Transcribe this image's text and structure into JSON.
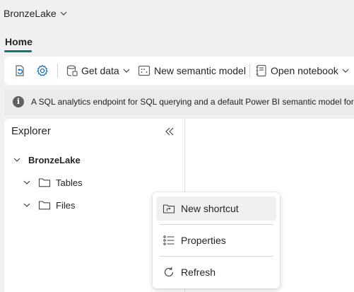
{
  "workspace": {
    "name": "BronzeLake"
  },
  "tabs": [
    {
      "label": "Home",
      "active": true
    }
  ],
  "ribbon": {
    "get_data_label": "Get data",
    "new_semantic_model_label": "New semantic model",
    "open_notebook_label": "Open notebook"
  },
  "info_bar": {
    "message": "A SQL analytics endpoint for SQL querying and a default Power BI semantic model for r"
  },
  "explorer": {
    "title": "Explorer",
    "tree": {
      "root": "BronzeLake",
      "children": [
        {
          "label": "Tables"
        },
        {
          "label": "Files"
        }
      ]
    }
  },
  "context_menu": {
    "items": [
      {
        "label": "New shortcut",
        "icon": "shortcut-icon",
        "highlighted": true
      },
      {
        "label": "Properties",
        "icon": "properties-list-icon"
      },
      {
        "label": "Refresh",
        "icon": "refresh-icon"
      }
    ]
  },
  "colors": {
    "accent": "#117865",
    "icon_blue": "#0f6cbd",
    "highlight": "#f0f0f0"
  }
}
